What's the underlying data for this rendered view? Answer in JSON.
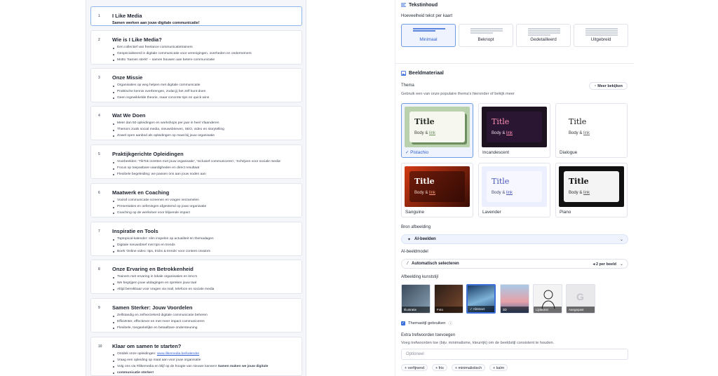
{
  "slides": [
    {
      "num": "1",
      "title": "I Like Media",
      "subtitle": "Samen werken aan jouw digitale communicatie!",
      "bullets": []
    },
    {
      "num": "2",
      "title": "Wie is I Like Media?",
      "bullets": [
        "Een collectief van freelance communicatietrainers",
        "Gespecialiseerd in digitale communicatie voor verenigingen, overheden en ondernemers",
        "Motto 'Samen sterk!' – samen bouwen aan betere communicatie"
      ]
    },
    {
      "num": "3",
      "title": "Onze Missie",
      "bullets": [
        "Organisaties op weg helpen met digitale communicatie",
        "Praktische kennis overbrengen, zodat jij het zelf kunt doen",
        "Geen ingewikkelde theorie, maar concrete tips en quick wins"
      ]
    },
    {
      "num": "4",
      "title": "Wat We Doen",
      "bullets": [
        "Meer dan 50 opleidingen en workshops per jaar in heel Vlaanderen",
        "Thema's zoals social media, nieuwsbrieven, SEO, video en storytelling",
        "Zowel open aanbod als opleidingen op maat bij jouw organisatie"
      ]
    },
    {
      "num": "5",
      "title": "Praktijkgerichte Opleidingen",
      "bullets": [
        "Voorbeelden: 'TikTok inzetten met jouw organisatie', 'Inclusief communiceren', 'Schrijven voor sociale media'",
        "Focus op toepasbare vaardigheden en direct resultaat",
        "Flexibele begeleiding: we passen ons aan jouw noden aan"
      ]
    },
    {
      "num": "6",
      "title": "Maatwerk en Coaching",
      "bullets": [
        "Vooraf communicatie screenen en vragen verzamelen",
        "Presentaties en oefeningen afgestemd op jouw organisatie",
        "Coaching op de werkvloer voor blijvende impact"
      ]
    },
    {
      "num": "7",
      "title": "Inspiratie en Tools",
      "bullets": [
        "Toptopical-kalender: slim inspelen op actualiteit en themadagen",
        "Digitale nieuwsbrief met tips en trends",
        "Boek 'Online video: tips, tricks & trends' voor content creators"
      ]
    },
    {
      "num": "8",
      "title": "Onze Ervaring en Betrokkenheid",
      "bullets": [
        "Trainers met ervaring in lokale organisaties en kmo's",
        "We begrijpen jouw uitdagingen en spreken jouw taal",
        "Altijd bereikbaar voor vragen via mail, telefoon en sociale media"
      ]
    },
    {
      "num": "9",
      "title": "Samen Sterker: Jouw Voordelen",
      "bullets": [
        "Zelfstandig en zelfverzekerd digitale communicatie beheren",
        "Efficiënter, effectiever en met meer impact communiceren",
        "Flexibele, toegankelijke en betaalbare ondersteuning"
      ]
    },
    {
      "num": "10",
      "title": "Klaar om samen te starten?",
      "bullets": [
        "Ontdek onze opleidingen: ",
        "Vraag een opleiding op maat aan voor jouw organisatie",
        "Volg ons via #ilikemedia en blijf op de hoogte van nieuwe kansen! "
      ],
      "link": "www.ilikemedia.be/kalender",
      "bold_end": "Samen maken we jouw digitale",
      "bold_end2": "communicatie sterker!"
    }
  ],
  "right": {
    "text_section_title": "Tekstinhoud",
    "amount_label": "Hoeveelheid tekst per kaart",
    "amounts": [
      "Minimaal",
      "Beknopt",
      "Gedetailleerd",
      "Uitgebreid"
    ],
    "image_section_title": "Beeldmateriaal",
    "theme_label": "Thema",
    "theme_hint": "Gebruik een van onze populaire thema's hieronder of bekijk meer",
    "more_button": "Meer bekijken",
    "themes": [
      {
        "name": "Pistachio",
        "title": "Title",
        "body": "Body & ",
        "link": "link"
      },
      {
        "name": "Incandescent",
        "title": "Title",
        "body": "Body & ",
        "link": "link"
      },
      {
        "name": "Dialogue",
        "title": "Title",
        "body": "Body & ",
        "link": "link"
      },
      {
        "name": "Sanguine",
        "title": "Title",
        "body": "Body & ",
        "link": "link"
      },
      {
        "name": "Lavender",
        "title": "Title",
        "body": "Body & ",
        "link": "link"
      },
      {
        "name": "Piano",
        "title": "Title",
        "body": "Body & ",
        "link": "link"
      }
    ],
    "source_label": "Bron afbeelding",
    "source_value": "AI-beelden",
    "model_label": "AI-beeldmodel",
    "model_value": "Automatisch selecteren",
    "model_right": "2 per beeld",
    "style_label": "Afbeelding kunststijl",
    "styles": [
      "Illustratie",
      "Foto",
      "Abstract",
      "3D",
      "Lijnkunst",
      "Aangepast"
    ],
    "themestyle_check": "Themastijl gebruiken",
    "keywords_label": "Extra trefwoorden toevoegen",
    "keywords_hint": "Voeg trefwoorden toe (bijv. minimalisme, kleurrijk) om de beeldstijl consistent te houden.",
    "keywords_placeholder": "Optioneel",
    "chips": [
      "+ verfijnend",
      "+ fris",
      "+ minimalistisch",
      "+ kalm"
    ]
  },
  "colors": {
    "accent": "#3b6fd9",
    "selected_bg": "#eef3fd"
  }
}
